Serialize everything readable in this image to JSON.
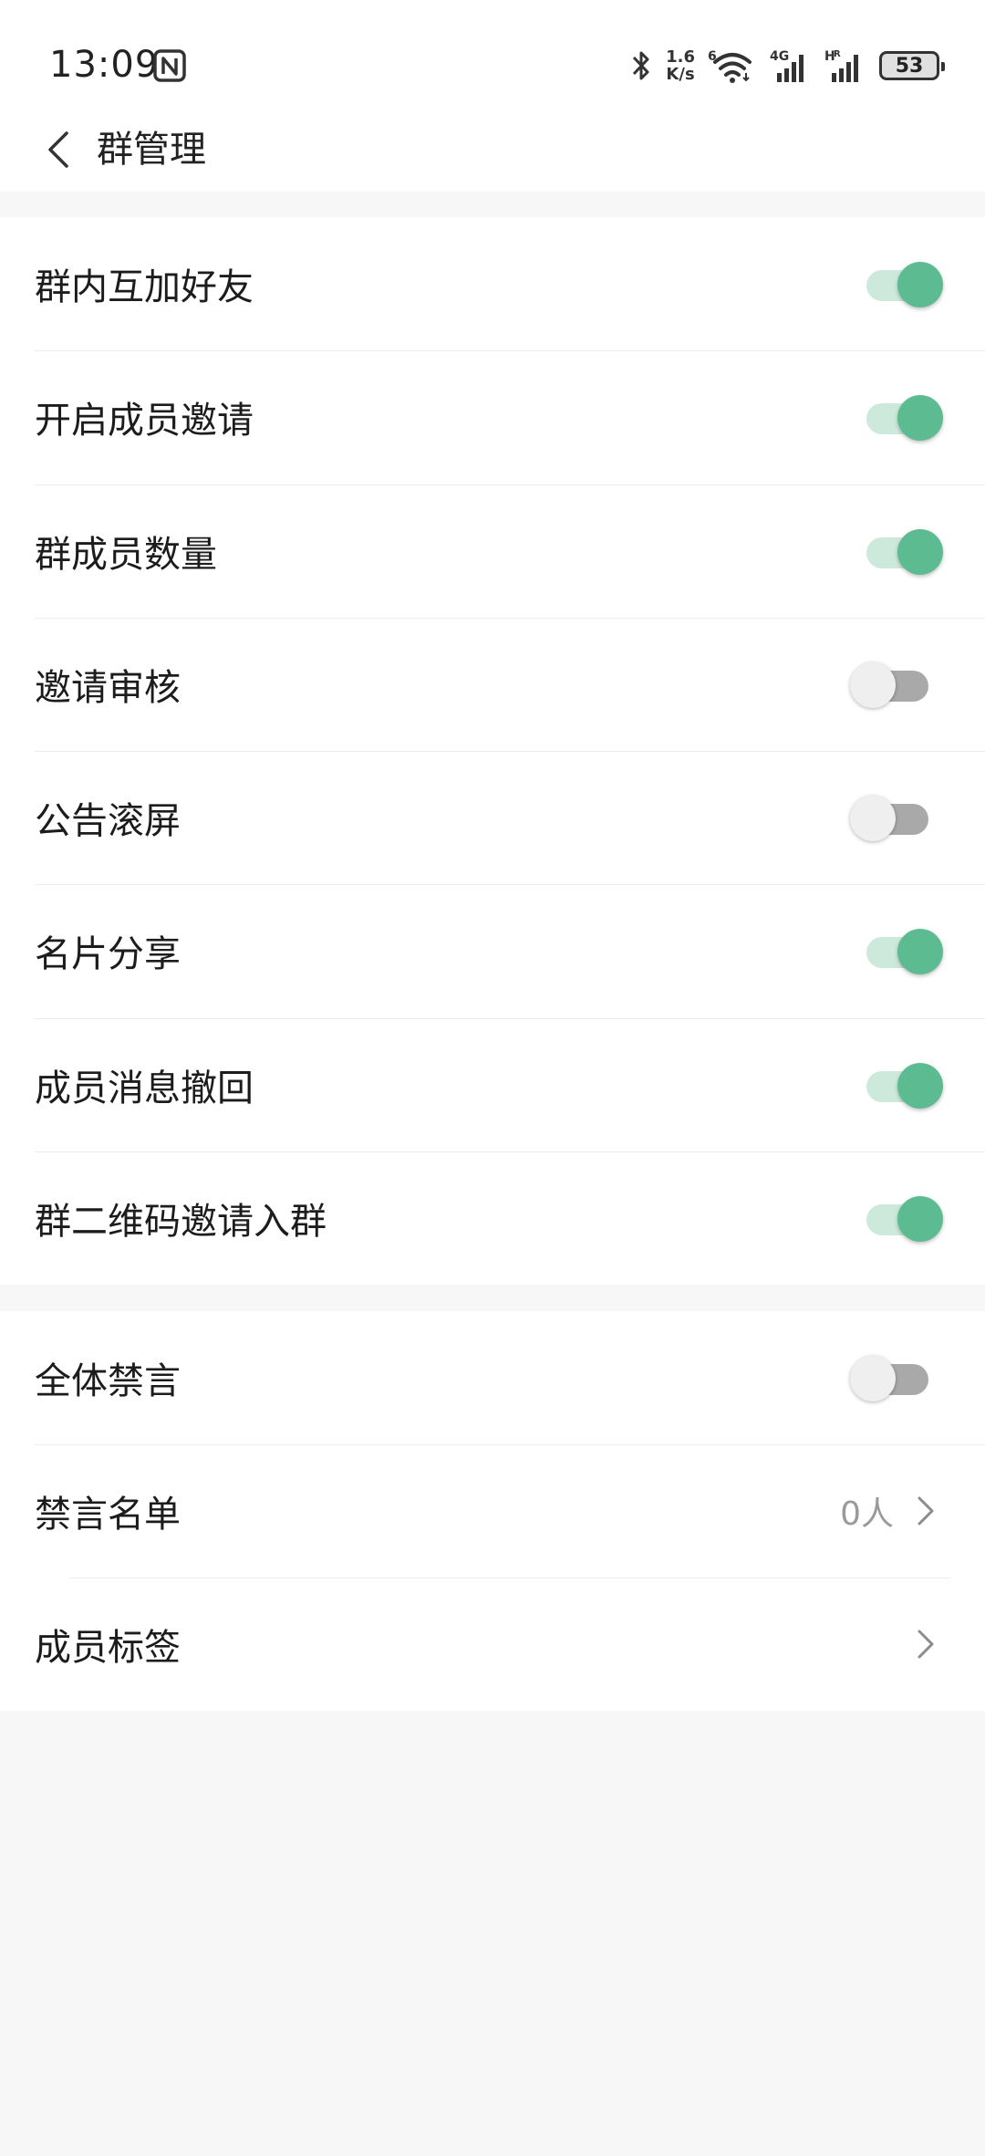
{
  "status_bar": {
    "time": "13:09",
    "net_speed_value": "1.6",
    "net_speed_unit": "K/s",
    "wifi_badge": "6",
    "sim1_label": "4G",
    "sim2_label": "H",
    "sim2_sub": "R",
    "battery": "53"
  },
  "header": {
    "title": "群管理"
  },
  "section1": {
    "rows": [
      {
        "label": "群内互加好友",
        "on": true
      },
      {
        "label": "开启成员邀请",
        "on": true
      },
      {
        "label": "群成员数量",
        "on": true
      },
      {
        "label": "邀请审核",
        "on": false
      },
      {
        "label": "公告滚屏",
        "on": false
      },
      {
        "label": "名片分享",
        "on": true
      },
      {
        "label": "成员消息撤回",
        "on": true
      },
      {
        "label": "群二维码邀请入群",
        "on": true
      }
    ]
  },
  "section2": {
    "mute_all_label": "全体禁言",
    "mute_all_on": false,
    "mute_list_label": "禁言名单",
    "mute_list_value": "0人",
    "member_tags_label": "成员标签"
  },
  "colors": {
    "accent": "#5dbb92",
    "accent_track": "#cde9dc",
    "off_track": "#a9a9a9",
    "background": "#f7f7f7"
  }
}
